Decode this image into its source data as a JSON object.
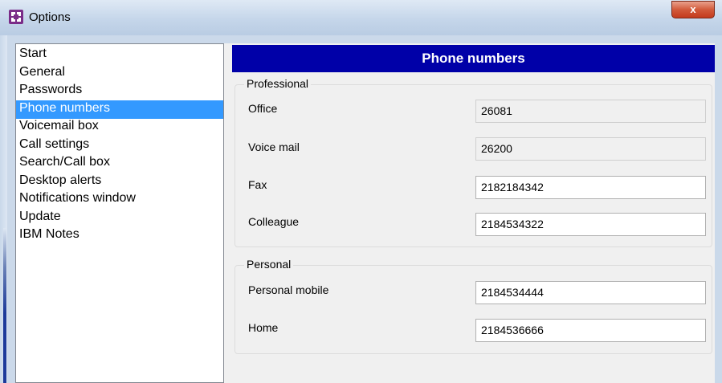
{
  "window": {
    "title": "Options",
    "close_label": "x"
  },
  "sidebar": {
    "items": [
      {
        "label": "Start"
      },
      {
        "label": "General"
      },
      {
        "label": "Passwords"
      },
      {
        "label": "Phone numbers",
        "selected": true
      },
      {
        "label": "Voicemail box"
      },
      {
        "label": "Call settings"
      },
      {
        "label": "Search/Call box"
      },
      {
        "label": "Desktop alerts"
      },
      {
        "label": "Notifications window"
      },
      {
        "label": "Update"
      },
      {
        "label": "IBM Notes"
      }
    ]
  },
  "page": {
    "header": "Phone numbers"
  },
  "professional": {
    "legend": "Professional",
    "office_label": "Office",
    "office_value": "26081",
    "voicemail_label": "Voice mail",
    "voicemail_value": "26200",
    "fax_label": "Fax",
    "fax_value": "2182184342",
    "colleague_label": "Colleague",
    "colleague_value": "2184534322"
  },
  "personal": {
    "legend": "Personal",
    "mobile_label": "Personal mobile",
    "mobile_value": "2184534444",
    "home_label": "Home",
    "home_value": "2184536666"
  },
  "colors": {
    "header_bg": "#0000a8",
    "selection": "#3399ff"
  }
}
